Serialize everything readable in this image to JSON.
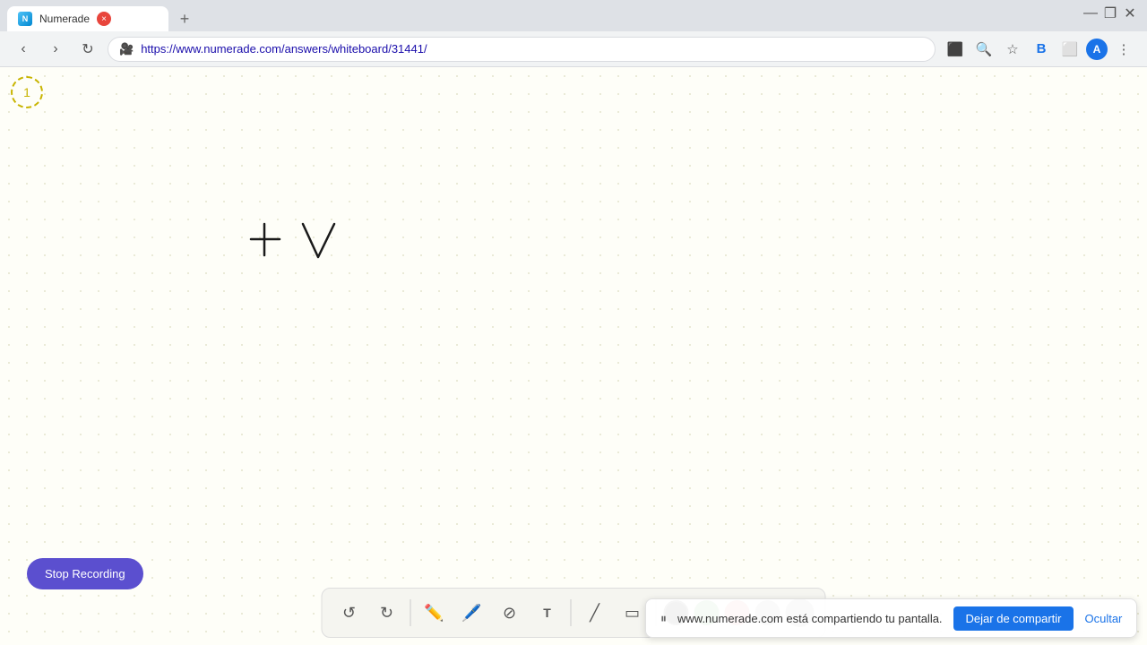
{
  "browser": {
    "tab": {
      "title": "Numerade",
      "favicon": "N",
      "url": "https://www.numerade.com/answers/whiteboard/31441/"
    },
    "window_controls": {
      "minimize": "—",
      "maximize": "❐",
      "close": "✕"
    }
  },
  "address_bar": {
    "url": "https://www.numerade.com/answers/whiteboard/31441/"
  },
  "page_indicator": "1",
  "whiteboard": {
    "content": "+ V"
  },
  "stop_recording_btn": "Stop Recording",
  "toolbar": {
    "undo_label": "↺",
    "redo_label": "↻",
    "pen_label": "✏",
    "eraser_label": "⊘",
    "text_label": "T",
    "line_label": "╱",
    "rect_label": "▭",
    "colors": [
      "black",
      "green",
      "gray",
      "red"
    ]
  },
  "sharing_bar": {
    "message": "www.numerade.com está compartiendo tu pantalla.",
    "stop_sharing_btn": "Dejar de compartir",
    "hide_btn": "Ocultar"
  }
}
